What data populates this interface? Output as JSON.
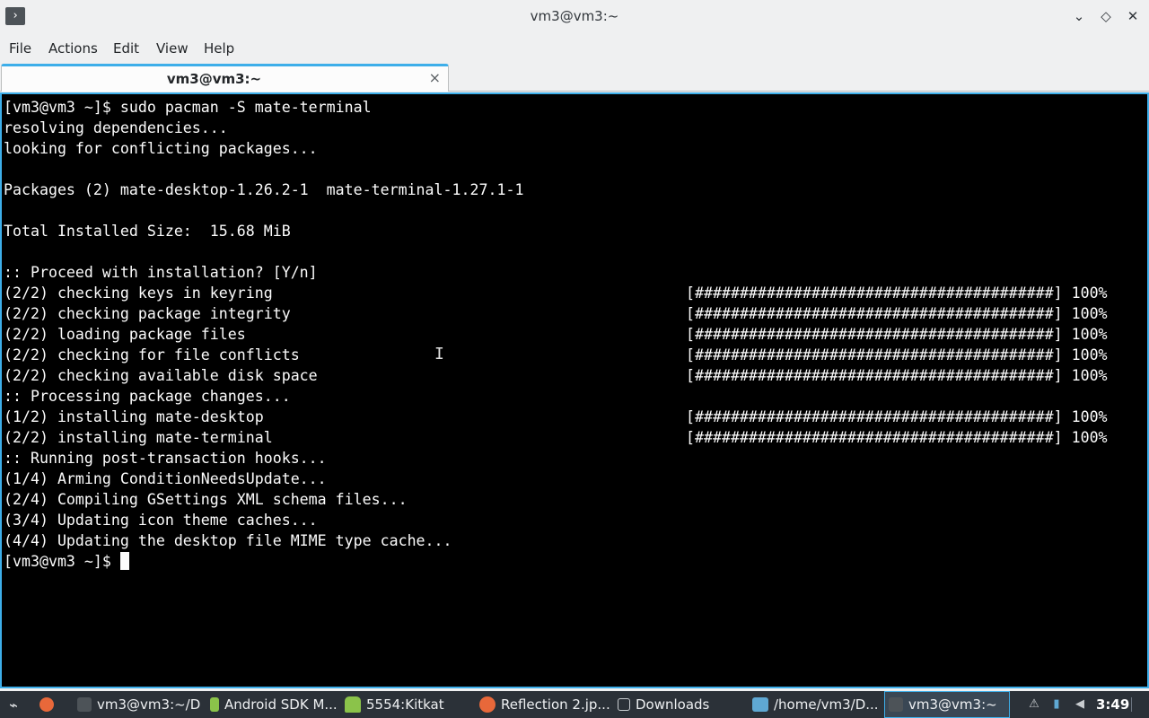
{
  "window": {
    "title": "vm3@vm3:~",
    "controls": {
      "minimize": "⌄",
      "maximize": "◇",
      "close": "✕"
    }
  },
  "menu": [
    "File",
    "Actions",
    "Edit",
    "View",
    "Help"
  ],
  "tab": {
    "label": "vm3@vm3:~",
    "close": "×"
  },
  "terminal": {
    "lines": [
      "[vm3@vm3 ~]$ sudo pacman -S mate-terminal",
      "resolving dependencies...",
      "looking for conflicting packages...",
      "",
      "Packages (2) mate-desktop-1.26.2-1  mate-terminal-1.27.1-1",
      "",
      "Total Installed Size:  15.68 MiB",
      "",
      ":: Proceed with installation? [Y/n]",
      "(2/2) checking keys in keyring",
      "(2/2) checking package integrity",
      "(2/2) loading package files",
      "(2/2) checking for file conflicts",
      "(2/2) checking available disk space",
      ":: Processing package changes...",
      "(1/2) installing mate-desktop",
      "(2/2) installing mate-terminal",
      ":: Running post-transaction hooks...",
      "(1/4) Arming ConditionNeedsUpdate...",
      "(2/4) Compiling GSettings XML schema files...",
      "(3/4) Updating icon theme caches...",
      "(4/4) Updating the desktop file MIME type cache...",
      "[vm3@vm3 ~]$ "
    ],
    "progress": [
      "",
      "",
      "",
      "",
      "",
      "",
      "",
      "",
      "",
      "[########################################] 100%",
      "[########################################] 100%",
      "[########################################] 100%",
      "[########################################] 100%",
      "[########################################] 100%",
      "",
      "[########################################] 100%",
      "[########################################] 100%"
    ]
  },
  "taskbar": {
    "items": [
      {
        "label": "vm3@vm3:~/D...",
        "icon": "terminal-icon",
        "color": "#4d5358"
      },
      {
        "label": "Android SDK M...",
        "icon": "android-download-icon",
        "color": "#8bc34a"
      },
      {
        "label": "5554:Kitkat",
        "icon": "android-icon",
        "color": "#8bc34a"
      },
      {
        "label": "Reflection 2.jp...",
        "icon": "firefox-icon",
        "color": "#e8683a"
      },
      {
        "label": "Downloads",
        "icon": "folder-icon",
        "color": "#2b3138"
      },
      {
        "label": "/home/vm3/D...",
        "icon": "image-viewer-icon",
        "color": "#5fa8d3"
      },
      {
        "label": "vm3@vm3:~",
        "icon": "terminal-icon",
        "color": "#4d5358"
      }
    ],
    "clock": "3:49"
  }
}
